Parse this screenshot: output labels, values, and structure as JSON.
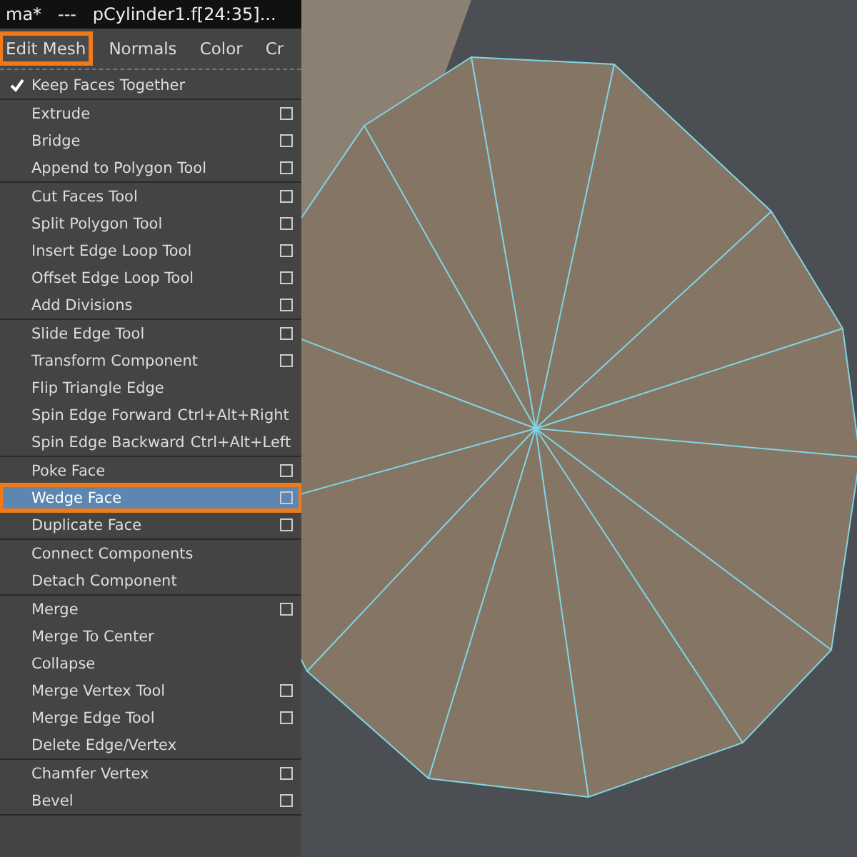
{
  "window": {
    "title": "ma*   ---   pCylinder1.f[24:35]..."
  },
  "menu_bar": [
    {
      "label": "Edit Mesh",
      "selected": true
    },
    {
      "label": "Normals",
      "selected": false
    },
    {
      "label": "Color",
      "selected": false
    },
    {
      "label": "Cr",
      "selected": false
    }
  ],
  "menu": {
    "groups": [
      [
        {
          "kind": "check",
          "label": "Keep Faces Together",
          "checked": true
        }
      ],
      [
        {
          "kind": "command",
          "label": "Extrude",
          "option_box": true,
          "selected": false
        },
        {
          "kind": "command",
          "label": "Bridge",
          "option_box": true,
          "selected": false
        },
        {
          "kind": "command",
          "label": "Append to Polygon Tool",
          "option_box": true,
          "selected": false
        }
      ],
      [
        {
          "kind": "command",
          "label": "Cut Faces Tool",
          "option_box": true,
          "selected": false
        },
        {
          "kind": "command",
          "label": "Split Polygon Tool",
          "option_box": true,
          "selected": false
        },
        {
          "kind": "command",
          "label": "Insert Edge Loop Tool",
          "option_box": true,
          "selected": false
        },
        {
          "kind": "command",
          "label": "Offset Edge Loop Tool",
          "option_box": true,
          "selected": false
        },
        {
          "kind": "command",
          "label": "Add Divisions",
          "option_box": true,
          "selected": false
        }
      ],
      [
        {
          "kind": "command",
          "label": "Slide Edge Tool",
          "option_box": true,
          "selected": false
        },
        {
          "kind": "command",
          "label": "Transform Component",
          "option_box": true,
          "selected": false
        },
        {
          "kind": "command",
          "label": "Flip Triangle Edge",
          "option_box": false,
          "selected": false
        },
        {
          "kind": "command",
          "label": "Spin Edge Forward",
          "shortcut": "Ctrl+Alt+Right",
          "option_box": false,
          "selected": false
        },
        {
          "kind": "command",
          "label": "Spin Edge Backward",
          "shortcut": "Ctrl+Alt+Left",
          "option_box": false,
          "selected": false
        }
      ],
      [
        {
          "kind": "command",
          "label": "Poke Face",
          "option_box": true,
          "selected": false
        },
        {
          "kind": "command",
          "label": "Wedge Face",
          "option_box": true,
          "selected": true
        },
        {
          "kind": "command",
          "label": "Duplicate Face",
          "option_box": true,
          "selected": false
        }
      ],
      [
        {
          "kind": "command",
          "label": "Connect Components",
          "option_box": false,
          "selected": false
        },
        {
          "kind": "command",
          "label": "Detach Component",
          "option_box": false,
          "selected": false
        }
      ],
      [
        {
          "kind": "command",
          "label": "Merge",
          "option_box": true,
          "selected": false
        },
        {
          "kind": "command",
          "label": "Merge To Center",
          "option_box": false,
          "selected": false
        },
        {
          "kind": "command",
          "label": "Collapse",
          "option_box": false,
          "selected": false
        },
        {
          "kind": "command",
          "label": "Merge Vertex Tool",
          "option_box": true,
          "selected": false
        },
        {
          "kind": "command",
          "label": "Merge Edge Tool",
          "option_box": true,
          "selected": false
        },
        {
          "kind": "command",
          "label": "Delete Edge/Vertex",
          "option_box": false,
          "selected": false
        }
      ],
      [
        {
          "kind": "command",
          "label": "Chamfer Vertex",
          "option_box": true,
          "selected": false
        },
        {
          "kind": "command",
          "label": "Bevel",
          "option_box": true,
          "selected": false
        }
      ]
    ]
  }
}
